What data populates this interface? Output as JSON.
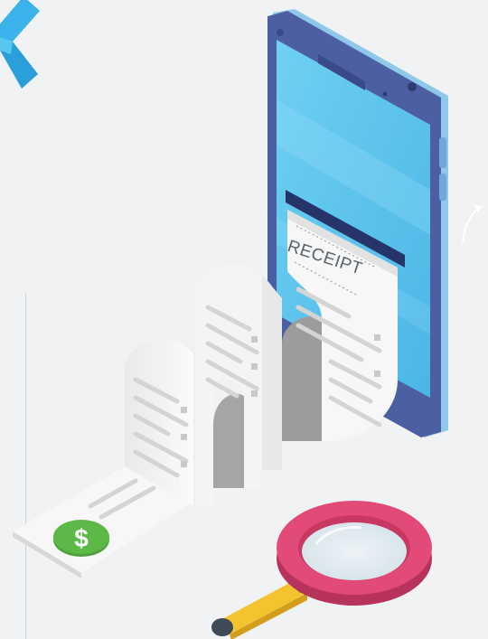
{
  "receipt": {
    "label": "RECEIPT"
  },
  "coin": {
    "symbol": "$"
  },
  "colors": {
    "background": "#f1f2f3",
    "phone_body": "#4d5fa3",
    "phone_screen": "#5bc4ea",
    "accent_blue": "#3ab6ec",
    "paper": "#f6f6f6",
    "paper_shadow": "#9a9c9e",
    "coin_green": "#5cb847",
    "magnifier_ring": "#d9406e",
    "magnifier_handle": "#f4c430"
  },
  "icons": [
    "back-chevron-icon",
    "dollar-coin-icon",
    "magnifying-glass-icon",
    "smartphone-icon"
  ]
}
